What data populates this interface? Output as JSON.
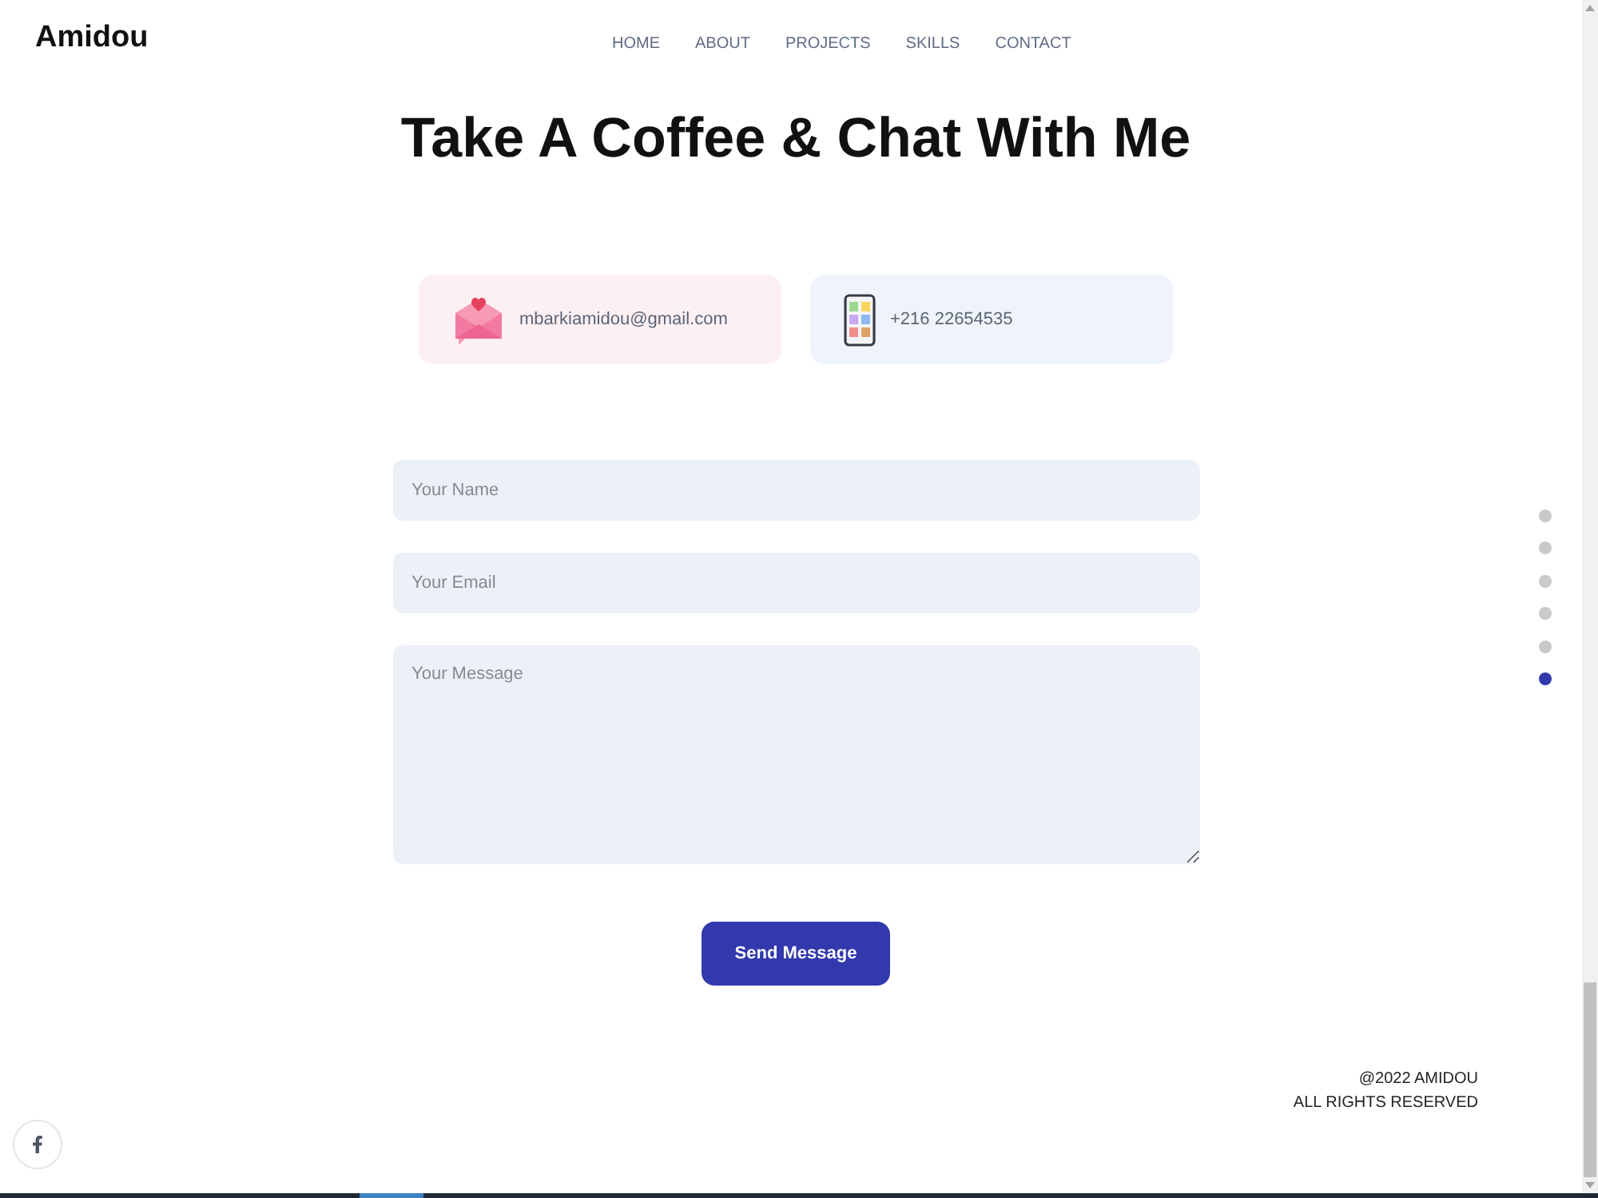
{
  "logo": "Amidou",
  "nav": [
    {
      "label": "HOME"
    },
    {
      "label": "ABOUT"
    },
    {
      "label": "PROJECTS"
    },
    {
      "label": "SKILLS"
    },
    {
      "label": "CONTACT"
    }
  ],
  "heading": "Take A Coffee & Chat With Me",
  "contacts": [
    {
      "kind": "email",
      "text": "mbarkiamidou@gmail.com"
    },
    {
      "kind": "phone",
      "text": "+216 22654535"
    }
  ],
  "form": {
    "fields": [
      {
        "kind": "input",
        "placeholder": "Your Name"
      },
      {
        "kind": "input",
        "placeholder": "Your Email"
      },
      {
        "kind": "textarea",
        "placeholder": "Your Message"
      }
    ],
    "submit": "Send Message"
  },
  "footer": {
    "lines": [
      "@2022 AMIDOU",
      "ALL RIGHTS RESERVED"
    ]
  },
  "section_dots": [
    {
      "selected": false
    },
    {
      "selected": false
    },
    {
      "selected": false
    },
    {
      "selected": false
    },
    {
      "selected": false
    },
    {
      "selected": true
    }
  ],
  "social": [
    {
      "kind": "facebook"
    }
  ]
}
